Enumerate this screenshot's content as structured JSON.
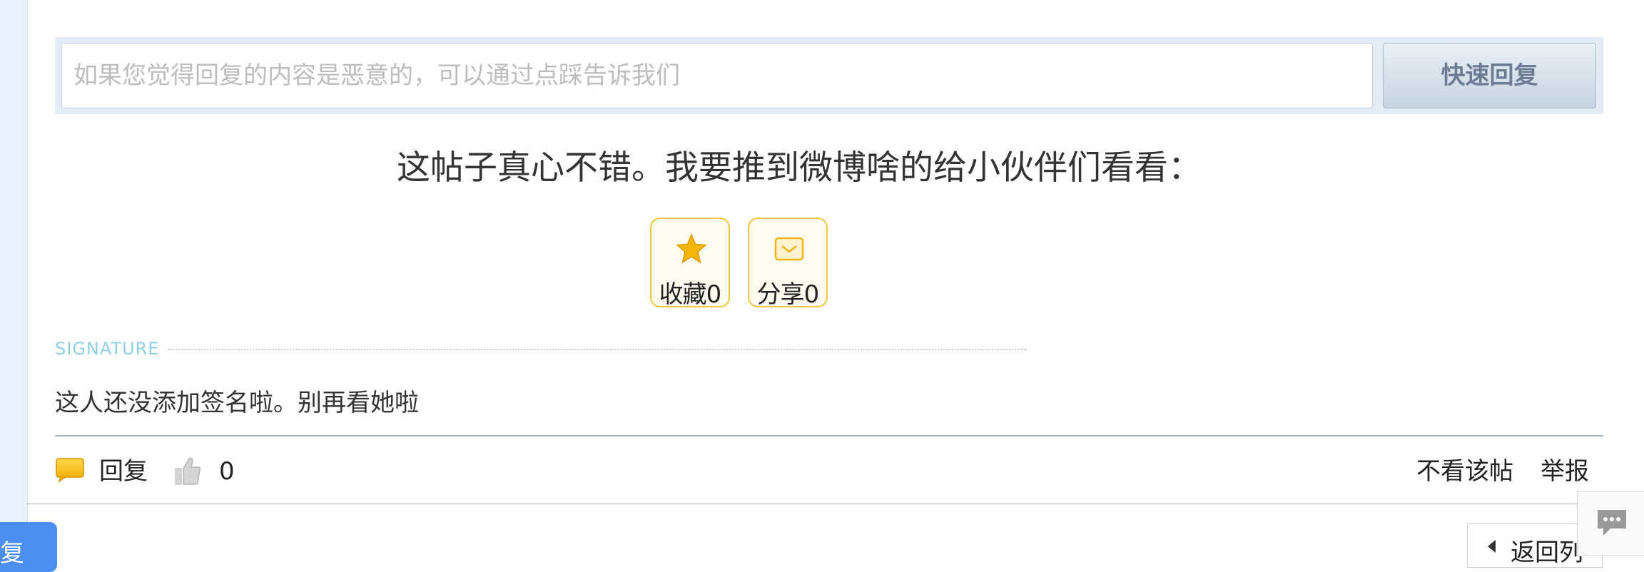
{
  "quick_reply": {
    "placeholder": "如果您觉得回复的内容是恶意的，可以通过点踩告诉我们",
    "button_label": "快速回复"
  },
  "promo_text": "这帖子真心不错。我要推到微博啥的给小伙伴们看看：",
  "actions": {
    "favorite_label": "收藏0",
    "share_label": "分享0",
    "favorite_icon": "star-icon",
    "share_icon": "envelope-icon"
  },
  "signature": {
    "heading": "SIGNATURE",
    "text": "这人还没添加签名啦。别再看她啦"
  },
  "footer": {
    "reply_label": "回复",
    "like_count": "0",
    "hide_label": "不看该帖",
    "report_label": "举报",
    "reply_icon": "speech-bubble-icon",
    "like_icon": "thumbs-up-icon"
  },
  "bottom": {
    "left_button_partial": "复",
    "back_label": "返回列",
    "chat_icon": "chat-icon"
  },
  "colors": {
    "accent_blue": "#4a8ff0",
    "action_border": "#f2c640",
    "signature_label": "#8fd0e4",
    "reply_bar_bg": "#e3ecf4"
  }
}
